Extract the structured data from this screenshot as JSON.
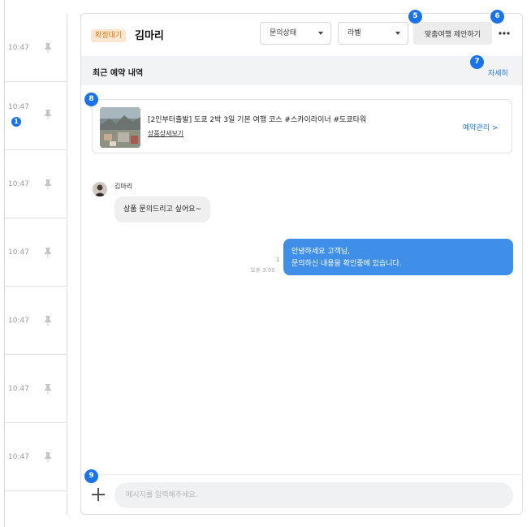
{
  "conversation_list": {
    "rows": [
      {
        "time": "10:47",
        "unread": null
      },
      {
        "time": "10:47",
        "unread": "1"
      },
      {
        "time": "10:47",
        "unread": null
      },
      {
        "time": "10:47",
        "unread": null
      },
      {
        "time": "10:47",
        "unread": null
      },
      {
        "time": "10:47",
        "unread": null
      },
      {
        "time": "10:47",
        "unread": null
      }
    ]
  },
  "header": {
    "status_tag": "확정대기",
    "customer_name": "김마리",
    "inquiry_status_label": "문의상태",
    "label_select_label": "라벨",
    "suggest_trip_button": "맞춤여행 제안하기"
  },
  "recent_booking": {
    "title": "최근 예약 내역",
    "detail_link": "자세히",
    "item": {
      "title": "[2인부터출발] 도쿄 2박 3일 기본 여행 코스 #스카이라이너 #도쿄타워",
      "detail_link": "상품상세보기",
      "manage_link": "예약관리 >"
    }
  },
  "messages": {
    "incoming": {
      "sender": "김마리",
      "text": "상품 문의드리고 싶어요~"
    },
    "outgoing": {
      "line1": "안녕하세요 고객님,",
      "line2": "문의하신 내용을 확인중에 있습니다.",
      "read_count": "1",
      "time": "오후 3:00"
    }
  },
  "composer": {
    "placeholder": "메시지를 입력해주세요."
  },
  "callouts": [
    "1",
    "5",
    "6",
    "7",
    "8",
    "9"
  ],
  "colors": {
    "accent": "#1a73e8",
    "outgoing_bubble": "#3f8fe8",
    "status_tag_bg": "#fde6cf",
    "status_tag_text": "#e07a14"
  }
}
